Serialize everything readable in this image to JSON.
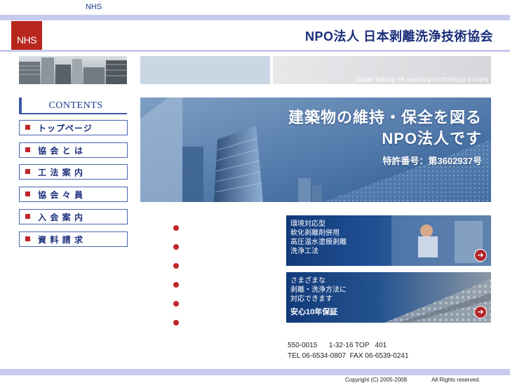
{
  "site": {
    "tag": "NHS",
    "logo": "NHS",
    "org_title": "NPO法人 日本剥離洗浄技術協会",
    "english_subtitle": "Japan flaking off washing technology society"
  },
  "sidebar": {
    "heading": "CONTENTS",
    "items": [
      {
        "label": "トップページ"
      },
      {
        "label": "協 会 と は"
      },
      {
        "label": "工 法 案 内"
      },
      {
        "label": "協 会 々 員"
      },
      {
        "label": "入 会 案 内"
      },
      {
        "label": "資 料 請 求"
      }
    ]
  },
  "hero": {
    "line1": "建築物の維持・保全を図る",
    "line2": "NPO法人です",
    "line3": "特許番号：第3602937号"
  },
  "features": [
    {
      "lines": [
        "環境対応型",
        "軟化剥離剤併用",
        "高圧温水塗膜剥離",
        "洗浄工法"
      ],
      "arrow": "➔"
    },
    {
      "lines": [
        "さまざまな",
        "剥離・洗浄方法に",
        "対応できます"
      ],
      "badge": "安心10年保証",
      "arrow": "➔"
    }
  ],
  "bullets_count": 6,
  "contact": {
    "line1": "550-0015      1-32-16 TOP   401",
    "line2": "TEL 06-6534-0807  FAX 06-6539-0241"
  },
  "footer": {
    "copyright": "Copyright (C) 2005-2008                All Rights reserved."
  },
  "colors": {
    "accent_blue": "#1a2e7a",
    "band_lavender": "#c8cbef",
    "logo_red": "#b8271e",
    "bullet_red": "#c0262a"
  }
}
